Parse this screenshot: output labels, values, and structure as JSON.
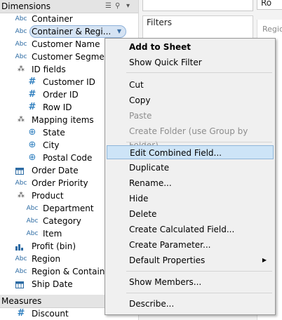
{
  "dimensions": {
    "header": "Dimensions",
    "tools": [
      "list-view-icon",
      "search-icon",
      "expand-icon"
    ],
    "fields": [
      {
        "label": "Container",
        "icon": "abc"
      },
      {
        "label": "Container & Regi...",
        "icon": "abc",
        "selected": true
      },
      {
        "label": "Customer Name",
        "icon": "abc"
      },
      {
        "label": "Customer Segment",
        "icon": "abc"
      },
      {
        "label": "ID fields",
        "icon": "hierarchy"
      },
      {
        "label": "Customer ID",
        "icon": "number"
      },
      {
        "label": "Order ID",
        "icon": "number"
      },
      {
        "label": "Row ID",
        "icon": "number"
      },
      {
        "label": "Mapping items",
        "icon": "hierarchy"
      },
      {
        "label": "State",
        "icon": "globe"
      },
      {
        "label": "City",
        "icon": "globe"
      },
      {
        "label": "Postal Code",
        "icon": "globe"
      },
      {
        "label": "Order Date",
        "icon": "calendar"
      },
      {
        "label": "Order Priority",
        "icon": "abc"
      },
      {
        "label": "Product",
        "icon": "hierarchy"
      },
      {
        "label": "Department",
        "icon": "abc"
      },
      {
        "label": "Category",
        "icon": "abc"
      },
      {
        "label": "Item",
        "icon": "abc"
      },
      {
        "label": "Profit (bin)",
        "icon": "bin"
      },
      {
        "label": "Region",
        "icon": "abc"
      },
      {
        "label": "Region & Container",
        "icon": "abc"
      },
      {
        "label": "Ship Date",
        "icon": "calendar"
      }
    ]
  },
  "measures": {
    "header": "Measures",
    "fields": [
      {
        "label": "Discount",
        "icon": "number"
      }
    ]
  },
  "panes": {
    "filters_title": "Filters",
    "rows_label": "Ro",
    "region_label": "Regio"
  },
  "context_menu": {
    "items": [
      {
        "label": "Add to Sheet",
        "bold": true
      },
      {
        "label": "Show Quick Filter"
      },
      {
        "separator": true
      },
      {
        "label": "Cut"
      },
      {
        "label": "Copy"
      },
      {
        "label": "Paste",
        "disabled": true
      },
      {
        "label": "Create Folder (use Group by Folder)",
        "disabled": true
      },
      {
        "separator": true
      },
      {
        "label": "Edit Combined Field...",
        "highlighted": true
      },
      {
        "label": "Duplicate"
      },
      {
        "label": "Rename..."
      },
      {
        "label": "Hide"
      },
      {
        "label": "Delete"
      },
      {
        "label": "Create Calculated Field..."
      },
      {
        "label": "Create Parameter..."
      },
      {
        "label": "Default Properties",
        "submenu": true
      },
      {
        "separator": true
      },
      {
        "label": "Show Members..."
      },
      {
        "separator": true
      },
      {
        "label": "Describe..."
      }
    ]
  },
  "colors": {
    "accent_blue": "#2b6aa3",
    "selection": "#d5e3f3",
    "menu_highlight": "#cde4f7",
    "disabled_text": "#8d8d8d"
  }
}
